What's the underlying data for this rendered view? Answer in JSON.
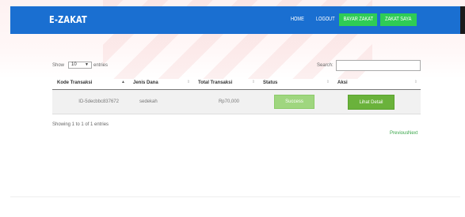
{
  "brand": "E-ZAKAT",
  "nav": {
    "home": "HOME",
    "logout": "LOGOUT",
    "bayar_zakat": "BAYAR ZAKAT",
    "zakat_saya": "ZAKAT SAYA"
  },
  "colors": {
    "navbar": "#1a6fd1",
    "nav_button": "#2fcc55",
    "status_success": "#9fd67f",
    "detail_button": "#6ab23b"
  },
  "controls": {
    "show_label": "Show",
    "length_value": "10",
    "entries_label": "entries",
    "search_label": "Search:",
    "search_value": ""
  },
  "table": {
    "columns": [
      "Kode Transaksi",
      "Jenis Dana",
      "Total Transaksi",
      "Status",
      "Aksi"
    ],
    "rows": [
      {
        "kode": "ID-5decbbc837672",
        "jenis": "sedekah",
        "total": "Rp70,000",
        "status": "Success",
        "aksi": "Lihat Detail"
      }
    ]
  },
  "info": "Showing 1 to 1 of 1 entries",
  "pagination": {
    "previous": "Previous",
    "next": "Next"
  }
}
